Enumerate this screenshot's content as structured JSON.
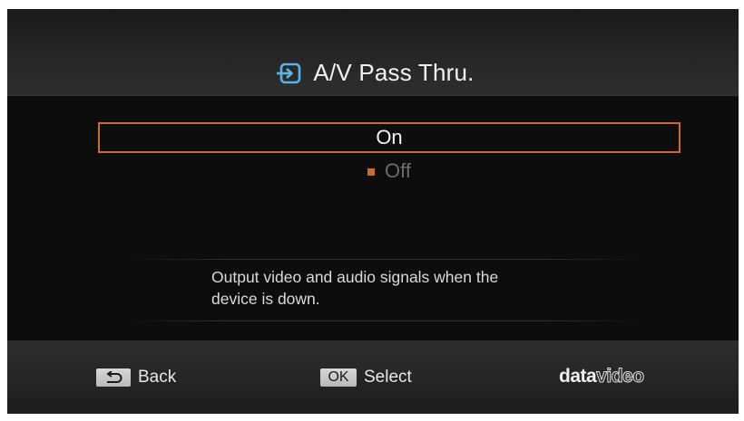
{
  "header": {
    "icon": "input-arrow-icon",
    "title": "A/V Pass Thru."
  },
  "options": [
    {
      "label": "On",
      "highlighted": true,
      "selected": false
    },
    {
      "label": "Off",
      "highlighted": false,
      "selected": true
    }
  ],
  "description": {
    "line1": "Output video and audio signals when the",
    "line2": "device is down."
  },
  "footer": {
    "back_label": "Back",
    "ok_key_label": "OK",
    "select_label": "Select"
  },
  "brand": {
    "logo_bold": "data",
    "logo_outline": "video"
  },
  "colors": {
    "accent": "#d2682a",
    "icon_blue": "#5ab4e6"
  }
}
